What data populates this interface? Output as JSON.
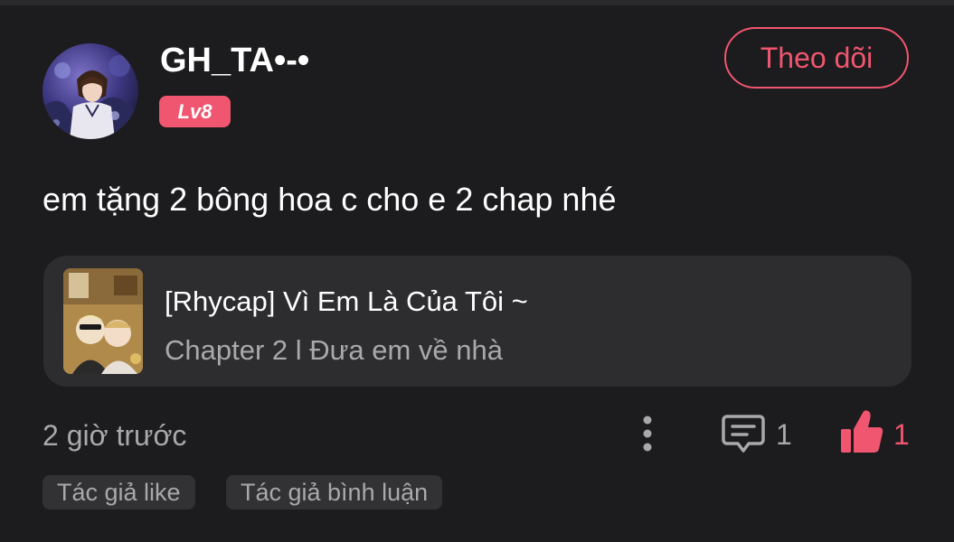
{
  "user": {
    "name": "GH_TA•-•",
    "level": "Lv8"
  },
  "follow_label": "Theo dõi",
  "comment": {
    "text": "em tặng 2 bông hoa c cho e 2 chap nhé"
  },
  "chapter_card": {
    "story_title": "[Rhycap] Vì Em Là Của Tôi ~",
    "chapter": "Chapter 2 l Đưa em về nhà"
  },
  "footer": {
    "time": "2 giờ trước",
    "reply_count": "1",
    "like_count": "1"
  },
  "tags": [
    "Tác giả like",
    "Tác giả bình luận"
  ],
  "icons": {
    "more": "more-vertical-icon",
    "reply": "comment-bubble-icon",
    "like": "thumbs-up-icon"
  },
  "colors": {
    "background": "#1c1b1d",
    "accent": "#f0566f",
    "card": "#2d2c2f",
    "muted_text": "#a9a8ab"
  }
}
